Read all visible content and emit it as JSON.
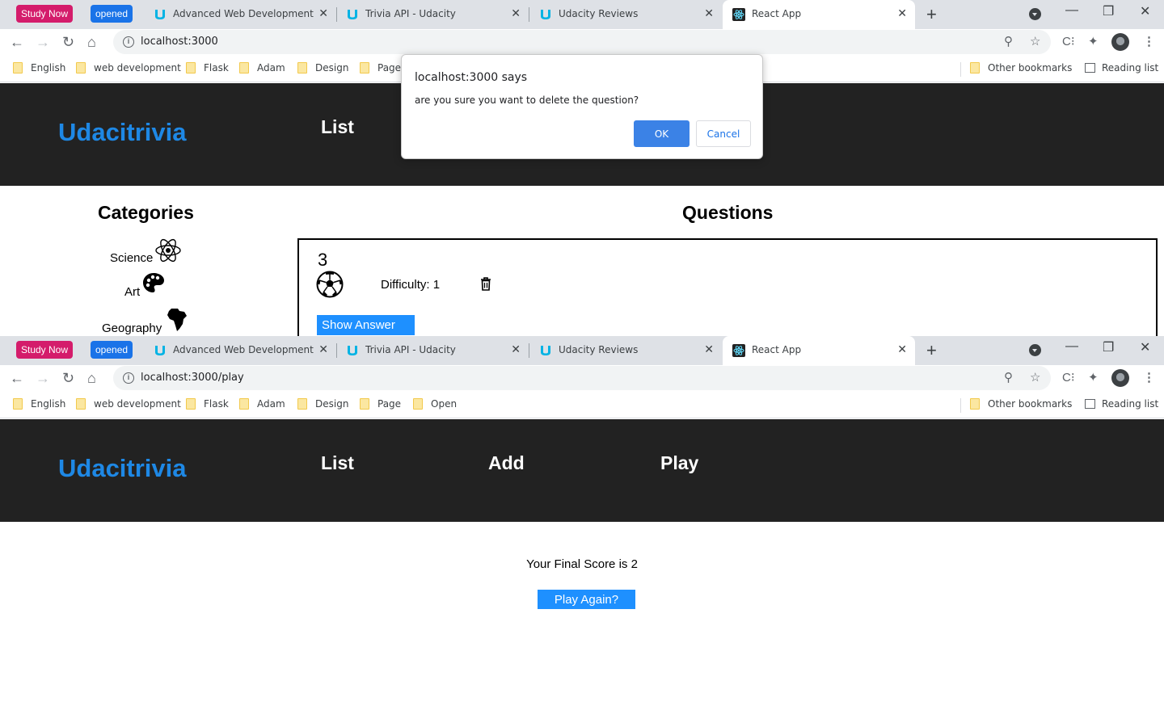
{
  "tab_groups": {
    "study": "Study Now",
    "opened": "opened"
  },
  "tabs": [
    {
      "title": "Advanced Web Development - U",
      "icon": "udacity-icon"
    },
    {
      "title": "Trivia API - Udacity",
      "icon": "udacity-icon"
    },
    {
      "title": "Udacity Reviews",
      "icon": "udacity-icon"
    },
    {
      "title": "React App",
      "icon": "react-icon"
    }
  ],
  "bookmarks": [
    "English",
    "web development",
    "Flask",
    "Adam",
    "Design",
    "Page",
    "Open"
  ],
  "bookmarks_right": {
    "other": "Other bookmarks",
    "reading": "Reading list"
  },
  "window1": {
    "url": "localhost:3000"
  },
  "window2": {
    "url": "localhost:3000/play"
  },
  "app": {
    "brand": "Udacitrivia",
    "nav": {
      "list": "List",
      "add": "Add",
      "play": "Play"
    }
  },
  "dialog": {
    "title": "localhost:3000 says",
    "message": "are you sure you want to delete the question?",
    "ok": "OK",
    "cancel": "Cancel"
  },
  "list_page": {
    "categories_heading": "Categories",
    "questions_heading": "Questions",
    "categories": [
      {
        "label": "Science",
        "icon": "atom-icon"
      },
      {
        "label": "Art",
        "icon": "palette-icon"
      },
      {
        "label": "Geography",
        "icon": "africa-icon"
      }
    ],
    "question": {
      "number": "3",
      "category_icon": "soccer-ball-icon",
      "difficulty": "Difficulty: 1",
      "show_answer": "Show Answer"
    }
  },
  "play_page": {
    "final_score": "Your Final Score is 2",
    "play_again": "Play Again?"
  },
  "colors": {
    "brand": "#1e88e5",
    "button": "#1e90ff",
    "header_bg": "#222222",
    "study_now": "#d41c6b",
    "opened": "#1a73e8"
  }
}
